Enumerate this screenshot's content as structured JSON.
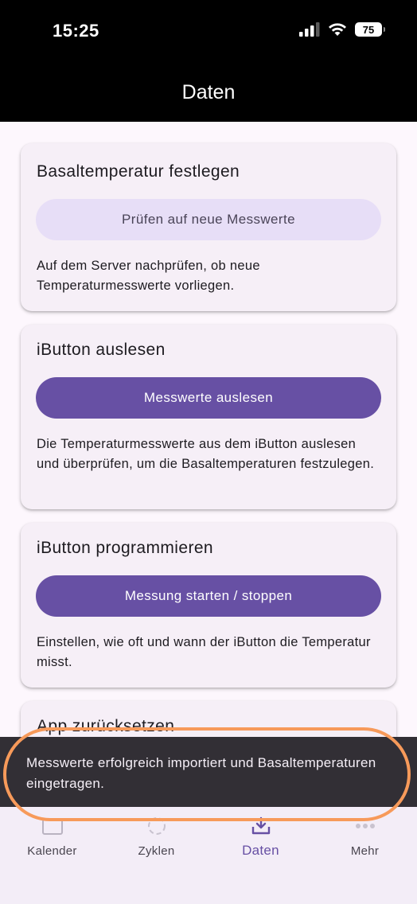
{
  "status_bar": {
    "time": "15:25",
    "battery": "75"
  },
  "app_bar": {
    "title": "Daten"
  },
  "cards": [
    {
      "title": "Basaltemperatur festlegen",
      "button": "Prüfen auf neue Messwerte",
      "description": "Auf dem Server nachprüfen, ob neue Temperaturmesswerte vorliegen."
    },
    {
      "title": "iButton auslesen",
      "button": "Messwerte auslesen",
      "description": "Die Temperaturmesswerte aus dem iButton auslesen und überprüfen, um die Basaltemperaturen festzulegen."
    },
    {
      "title": "iButton programmieren",
      "button": "Messung starten / stoppen",
      "description": "Einstellen, wie oft und wann der iButton die Temperatur misst."
    },
    {
      "title": "App zurücksetzen"
    }
  ],
  "snackbar": {
    "message": "Messwerte erfolgreich importiert und Basaltemperaturen eingetragen."
  },
  "bottom_nav": {
    "items": [
      {
        "label": "Kalender",
        "icon": "calendar-icon"
      },
      {
        "label": "Zyklen",
        "icon": "cycle-icon"
      },
      {
        "label": "Daten",
        "icon": "download-icon",
        "active": true
      },
      {
        "label": "Mehr",
        "icon": "more-icon"
      }
    ]
  },
  "colors": {
    "primary": "#6750a4",
    "tonal": "#e7def7",
    "snackbar": "#322f35",
    "highlight": "#f79a5a"
  }
}
